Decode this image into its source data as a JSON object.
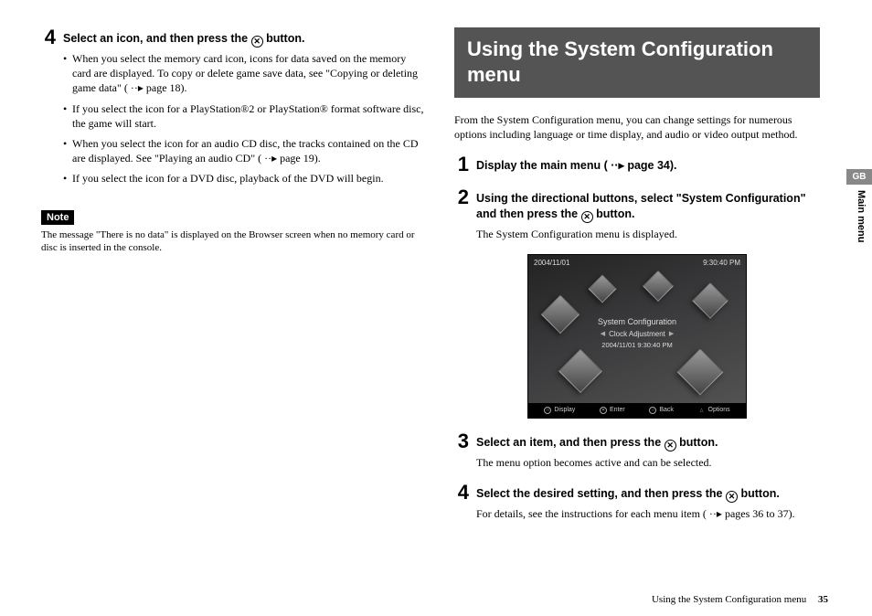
{
  "left": {
    "step4": {
      "num": "4",
      "title_a": "Select an icon, and then press the ",
      "title_b": " button.",
      "bullets": [
        "When you select the memory card icon, icons for data saved on the memory card are displayed. To copy or delete game save data, see \"Copying or deleting game data\" ( ··▸ page 18).",
        "If you select the icon for a PlayStation®2 or PlayStation® format software disc, the game will start.",
        "When you select the icon for an audio CD disc, the tracks contained on the CD are displayed. See \"Playing an audio CD\" ( ··▸ page 19).",
        "If you select the icon for a DVD disc, playback of the DVD will begin."
      ]
    },
    "note_label": "Note",
    "note_text": "The message \"There is no data\" is displayed on the Browser screen when no memory card or disc is inserted in the console."
  },
  "right": {
    "section_title": "Using the System Configuration menu",
    "intro": "From the System Configuration menu, you can change settings for numerous options including language or time display, and audio or video output method.",
    "step1": {
      "num": "1",
      "title": "Display the main menu ( ··▸ page 34)."
    },
    "step2": {
      "num": "2",
      "title_a": "Using the directional buttons, select \"System Configuration\" and then press the ",
      "title_b": " button.",
      "body": "The System Configuration menu is displayed."
    },
    "screen": {
      "top_date": "2004/11/01",
      "top_time": "9:30:40 PM",
      "menu_title": "System Configuration",
      "menu_item": "Clock Adjustment",
      "menu_value": "2004/11/01   9:30:40 PM",
      "foot": {
        "display": "Display",
        "enter": "Enter",
        "back": "Back",
        "options": "Options"
      }
    },
    "step3": {
      "num": "3",
      "title_a": "Select an item, and then press the ",
      "title_b": " button.",
      "body": "The menu option becomes active and can be selected."
    },
    "step4": {
      "num": "4",
      "title_a": "Select the desired setting, and then press the ",
      "title_b": " button.",
      "body": "For details, see the instructions for each menu item ( ··▸ pages 36 to 37)."
    }
  },
  "side": {
    "region": "GB",
    "section": "Main menu"
  },
  "footer": {
    "title": "Using the System Configuration menu",
    "page": "35"
  },
  "icons": {
    "x": "✕"
  }
}
